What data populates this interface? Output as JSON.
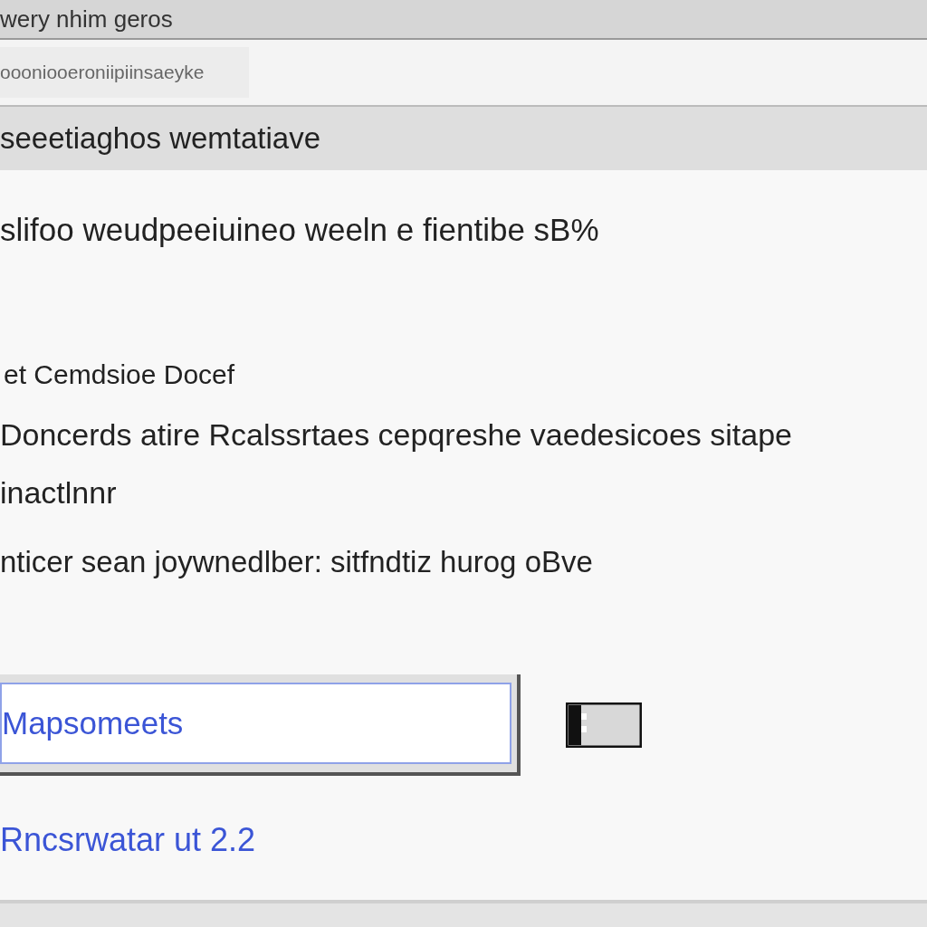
{
  "window": {
    "title": "wery nhim geros"
  },
  "address_bar": {
    "value": "oooniooeroniipiinsaeyke"
  },
  "header": {
    "title": "seeetiaghos wemtatiave"
  },
  "body": {
    "intro": "slifoo weudpeeiuineo weeln e fientibe sB%",
    "section_title": "et Cemdsioe Docef",
    "description": "Doncerds atire Rcalssrtaes cepqreshe vaedesicoes sitape inactlnnr",
    "note": "nticer sean joywnedlber: sitfndtiz hurog oBve"
  },
  "field": {
    "value": "Mapsomeets"
  },
  "link": {
    "text": "Rncsrwatar ut 2.2"
  }
}
